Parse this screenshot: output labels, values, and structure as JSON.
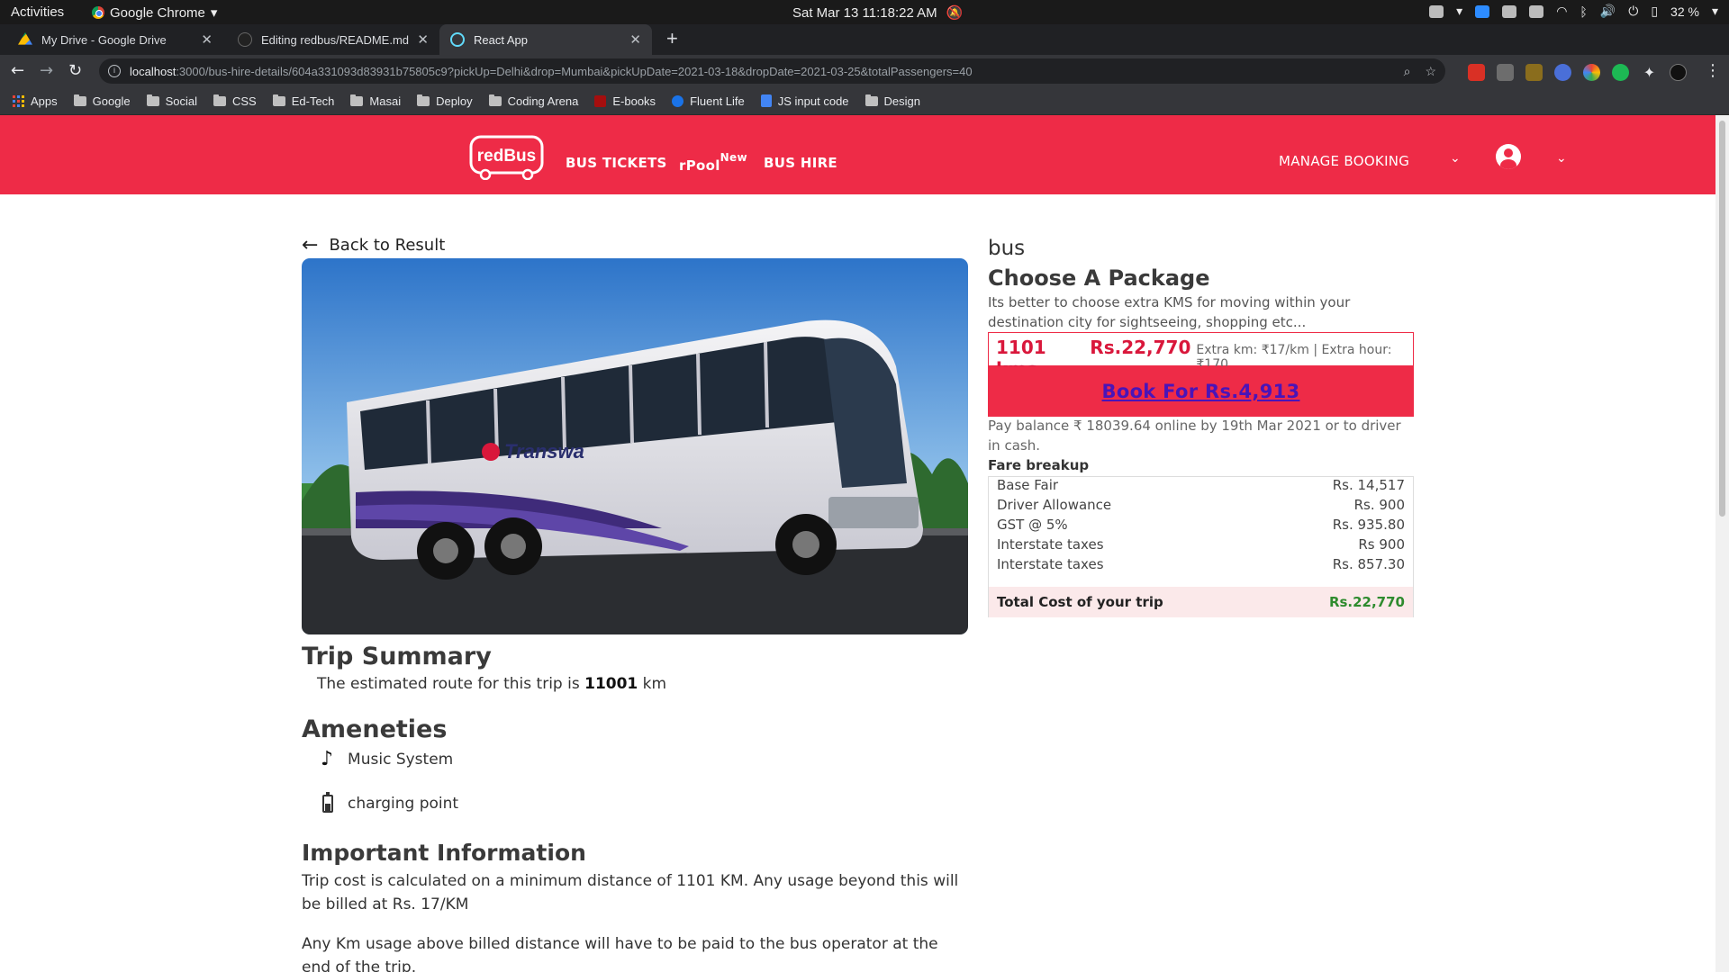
{
  "os_bar": {
    "activities": "Activities",
    "app_name": "Google Chrome",
    "clock": "Sat Mar 13  11:18:22 AM",
    "battery": "32 %"
  },
  "tabs": [
    {
      "title": "My Drive - Google Drive",
      "favicon_color": "#fbbc05"
    },
    {
      "title": "Editing redbus/README.md at",
      "favicon_color": "#222222"
    },
    {
      "title": "React App",
      "favicon_color": "#61dafb"
    }
  ],
  "address": {
    "host": "localhost",
    "path": ":3000/bus-hire-details/604a331093d83931b75805c9?pickUp=Delhi&drop=Mumbai&pickUpDate=2021-03-18&dropDate=2021-03-25&totalPassengers=40"
  },
  "bookmarks": [
    "Apps",
    "Google",
    "Social",
    "CSS",
    "Ed-Tech",
    "Masai",
    "Deploy",
    "Coding Arena",
    "E-books",
    "Fluent Life",
    "JS input code",
    "Design"
  ],
  "header": {
    "logo_text": "redBus",
    "nav": {
      "bus_tickets": "BUS TICKETS",
      "rpool": "rPool",
      "rpool_badge": "New",
      "bus_hire": "BUS HIRE"
    },
    "manage_booking": "MANAGE BOOKING",
    "brand_color": "#ee2b47"
  },
  "left": {
    "back_label": "Back to Result",
    "bus_brand_text": "Transwa",
    "trip_summary_title": "Trip Summary",
    "trip_text_prefix": "The estimated route for this trip is",
    "trip_km": "11001",
    "trip_unit": "km",
    "amenities_title": "Ameneties",
    "amenities": [
      "Music System",
      "charging point"
    ],
    "important_title": "Important Information",
    "important_paragraphs": [
      "Trip cost is calculated on a minimum distance of 1101 KM. Any usage beyond this will be billed at Rs. 17/KM",
      "Any Km usage above billed distance will have to be paid to the bus operator at the end of the trip."
    ]
  },
  "right": {
    "bus_type": "bus",
    "choose_title": "Choose A Package",
    "choose_desc": "Its better to choose extra KMS for moving within your destination city for sightseeing, shopping etc...",
    "package": {
      "kms": "1101 kms",
      "price": "Rs.22,770",
      "extra": "Extra km: ₹17/km | Extra hour: ₹170"
    },
    "book_button": "Book For Rs.4,913",
    "pay_balance": "Pay balance ₹ 18039.64 online by 19th Mar 2021 or to driver in cash.",
    "fare_title": "Fare breakup",
    "fare_rows": [
      {
        "label": "Base Fair",
        "amount": "Rs. 14,517"
      },
      {
        "label": "Driver Allowance",
        "amount": "Rs. 900"
      },
      {
        "label": "GST @ 5%",
        "amount": "Rs. 935.80"
      },
      {
        "label": "Interstate taxes",
        "amount": "Rs 900"
      },
      {
        "label": "Interstate taxes",
        "amount": "Rs. 857.30"
      }
    ],
    "total_label": "Total Cost of your trip",
    "total_amount": "Rs.22,770"
  }
}
